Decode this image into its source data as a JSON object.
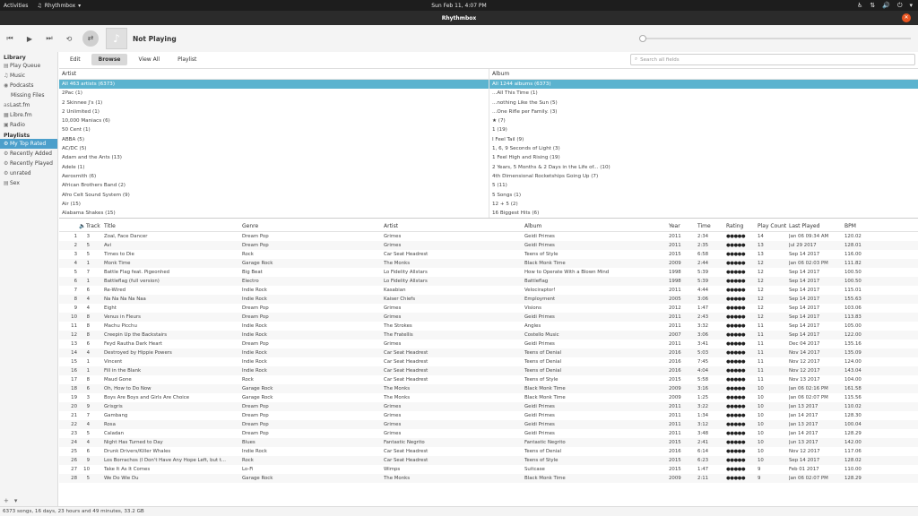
{
  "topbar": {
    "activities": "Activities",
    "app_name": "Rhythmbox",
    "clock": "Sun Feb 11,  4:07 PM"
  },
  "window": {
    "title": "Rhythmbox"
  },
  "player": {
    "now_playing": "Not Playing"
  },
  "sidebar": {
    "library_header": "Library",
    "library_items": [
      {
        "label": "Play Queue",
        "icon": "queue-icon"
      },
      {
        "label": "Music",
        "icon": "music-icon"
      },
      {
        "label": "Podcasts",
        "icon": "podcast-icon"
      },
      {
        "label": "Missing Files",
        "icon": ""
      }
    ],
    "online_items": [
      {
        "label": "Last.fm",
        "icon": "lastfm-icon"
      },
      {
        "label": "Libre.fm",
        "icon": "librefm-icon"
      },
      {
        "label": "Radio",
        "icon": "radio-icon"
      }
    ],
    "playlists_header": "Playlists",
    "playlist_items": [
      {
        "label": "My Top Rated",
        "icon": "smart-playlist-icon",
        "active": true
      },
      {
        "label": "Recently Added",
        "icon": "smart-playlist-icon"
      },
      {
        "label": "Recently Played",
        "icon": "smart-playlist-icon"
      },
      {
        "label": "unrated",
        "icon": "smart-playlist-icon"
      },
      {
        "label": "Sex",
        "icon": "playlist-icon"
      }
    ]
  },
  "tabs": [
    {
      "label": "Edit",
      "active": false
    },
    {
      "label": "Browse",
      "active": true
    },
    {
      "label": "View All",
      "active": false
    },
    {
      "label": "Playlist",
      "active": false
    }
  ],
  "search": {
    "placeholder": "Search all fields"
  },
  "browser": {
    "artist_header": "Artist",
    "album_header": "Album",
    "artists": [
      "All 463 artists (6373)",
      "2Pac (1)",
      "2 Skinnee J's (1)",
      "2 Unlimited (1)",
      "10,000 Maniacs (6)",
      "50 Cent (1)",
      "ABBA (5)",
      "AC/DC (5)",
      "Adam and the Ants (13)",
      "Adele (1)",
      "Aerosmith (6)",
      "African Brothers Band (2)",
      "Afro Celt Sound System (9)",
      "Air (15)",
      "Alabama Shakes (15)"
    ],
    "albums": [
      "All 1244 albums (6373)",
      "...All This Time (1)",
      "...nothing Like the Sun (5)",
      "...One Rifle per Family. (3)",
      "★ (7)",
      "1 (19)",
      "I Feel Tail (9)",
      "1, 6, 9 Seconds of Light (3)",
      "1 Feel High and Rising (19)",
      "2 Years, 5 Months & 2 Days in the Life of... (10)",
      "4th Dimensional Rocketships Going Up (7)",
      "5 (11)",
      "5 Songs (1)",
      "12 + 5 (2)",
      "16 Biggest Hits (6)"
    ]
  },
  "tracks": {
    "columns": {
      "track": "Track",
      "title": "Title",
      "genre": "Genre",
      "artist": "Artist",
      "album": "Album",
      "year": "Year",
      "time": "Time",
      "rating": "Rating",
      "play_count": "Play Count",
      "last_played": "Last Played",
      "bpm": "BPM"
    },
    "rows": [
      {
        "num": "1",
        "track": "3",
        "title": "Zoal, Face Dancer",
        "genre": "Dream Pop",
        "artist": "Grimes",
        "album": "Geidi Primes",
        "year": "2011",
        "time": "2:34",
        "stars": 5,
        "plays": "14",
        "last": "Jan 06 09:34 AM",
        "bpm": "120.02"
      },
      {
        "num": "2",
        "track": "5",
        "title": "Avi",
        "genre": "Dream Pop",
        "artist": "Grimes",
        "album": "Geidi Primes",
        "year": "2011",
        "time": "2:35",
        "stars": 5,
        "plays": "13",
        "last": "Jul 29 2017",
        "bpm": "128.01"
      },
      {
        "num": "3",
        "track": "5",
        "title": "Times to Die",
        "genre": "Rock",
        "artist": "Car Seat Headrest",
        "album": "Teens of Style",
        "year": "2015",
        "time": "6:58",
        "stars": 5,
        "plays": "13",
        "last": "Sep 14 2017",
        "bpm": "116.00"
      },
      {
        "num": "4",
        "track": "1",
        "title": "Monk Time",
        "genre": "Garage Rock",
        "artist": "The Monks",
        "album": "Black Monk Time",
        "year": "2009",
        "time": "2:44",
        "stars": 5,
        "plays": "12",
        "last": "Jan 06 02:03 PM",
        "bpm": "111.82"
      },
      {
        "num": "5",
        "track": "7",
        "title": "Battle Flag feat. Pigeonhed",
        "genre": "Big Beat",
        "artist": "Lo Fidelity Allstars",
        "album": "How to Operate With a Blown Mind",
        "year": "1998",
        "time": "5:39",
        "stars": 5,
        "plays": "12",
        "last": "Sep 14 2017",
        "bpm": "100.50"
      },
      {
        "num": "6",
        "track": "1",
        "title": "Battleflag (full version)",
        "genre": "Electro",
        "artist": "Lo Fidelity Allstars",
        "album": "Battleflag",
        "year": "1998",
        "time": "5:39",
        "stars": 5,
        "plays": "12",
        "last": "Sep 14 2017",
        "bpm": "100.50"
      },
      {
        "num": "7",
        "track": "6",
        "title": "Re-Wired",
        "genre": "Indie Rock",
        "artist": "Kasabian",
        "album": "Velociraptor!",
        "year": "2011",
        "time": "4:44",
        "stars": 5,
        "plays": "12",
        "last": "Sep 14 2017",
        "bpm": "115.01"
      },
      {
        "num": "8",
        "track": "4",
        "title": "Na Na Na Na Naa",
        "genre": "Indie Rock",
        "artist": "Kaiser Chiefs",
        "album": "Employment",
        "year": "2005",
        "time": "3:06",
        "stars": 5,
        "plays": "12",
        "last": "Sep 14 2017",
        "bpm": "155.63"
      },
      {
        "num": "9",
        "track": "4",
        "title": "Eight",
        "genre": "Dream Pop",
        "artist": "Grimes",
        "album": "Visions",
        "year": "2012",
        "time": "1:47",
        "stars": 5,
        "plays": "12",
        "last": "Sep 14 2017",
        "bpm": "103.06"
      },
      {
        "num": "10",
        "track": "8",
        "title": "Venus in Fleurs",
        "genre": "Dream Pop",
        "artist": "Grimes",
        "album": "Geidi Primes",
        "year": "2011",
        "time": "2:43",
        "stars": 5,
        "plays": "12",
        "last": "Sep 14 2017",
        "bpm": "113.83"
      },
      {
        "num": "11",
        "track": "8",
        "title": "Machu Picchu",
        "genre": "Indie Rock",
        "artist": "The Strokes",
        "album": "Angles",
        "year": "2011",
        "time": "3:32",
        "stars": 5,
        "plays": "11",
        "last": "Sep 14 2017",
        "bpm": "105.00"
      },
      {
        "num": "12",
        "track": "8",
        "title": "Creepin Up the Backstairs",
        "genre": "Indie Rock",
        "artist": "The Fratellis",
        "album": "Costello Music",
        "year": "2007",
        "time": "3:06",
        "stars": 5,
        "plays": "11",
        "last": "Sep 14 2017",
        "bpm": "122.00"
      },
      {
        "num": "13",
        "track": "6",
        "title": "Feyd Rautha Dark Heart",
        "genre": "Dream Pop",
        "artist": "Grimes",
        "album": "Geidi Primes",
        "year": "2011",
        "time": "3:41",
        "stars": 5,
        "plays": "11",
        "last": "Dec 04 2017",
        "bpm": "135.16"
      },
      {
        "num": "14",
        "track": "4",
        "title": "Destroyed by Hippie Powers",
        "genre": "Indie Rock",
        "artist": "Car Seat Headrest",
        "album": "Teens of Denial",
        "year": "2016",
        "time": "5:03",
        "stars": 5,
        "plays": "11",
        "last": "Nov 14 2017",
        "bpm": "135.09"
      },
      {
        "num": "15",
        "track": "1",
        "title": "Vincent",
        "genre": "Indie Rock",
        "artist": "Car Seat Headrest",
        "album": "Teens of Denial",
        "year": "2016",
        "time": "7:45",
        "stars": 5,
        "plays": "11",
        "last": "Nov 12 2017",
        "bpm": "124.00"
      },
      {
        "num": "16",
        "track": "1",
        "title": "Fill in the Blank",
        "genre": "Indie Rock",
        "artist": "Car Seat Headrest",
        "album": "Teens of Denial",
        "year": "2016",
        "time": "4:04",
        "stars": 5,
        "plays": "11",
        "last": "Nov 12 2017",
        "bpm": "143.04"
      },
      {
        "num": "17",
        "track": "8",
        "title": "Maud Gone",
        "genre": "Rock",
        "artist": "Car Seat Headrest",
        "album": "Teens of Style",
        "year": "2015",
        "time": "5:58",
        "stars": 5,
        "plays": "11",
        "last": "Nov 13 2017",
        "bpm": "104.00"
      },
      {
        "num": "18",
        "track": "6",
        "title": "Oh, How to Do Now",
        "genre": "Garage Rock",
        "artist": "The Monks",
        "album": "Black Monk Time",
        "year": "2009",
        "time": "3:16",
        "stars": 5,
        "plays": "10",
        "last": "Jan 06 02:16 PM",
        "bpm": "161.58"
      },
      {
        "num": "19",
        "track": "3",
        "title": "Boys Are Boys and Girls Are Choice",
        "genre": "Garage Rock",
        "artist": "The Monks",
        "album": "Black Monk Time",
        "year": "2009",
        "time": "1:25",
        "stars": 5,
        "plays": "10",
        "last": "Jan 06 02:07 PM",
        "bpm": "115.56"
      },
      {
        "num": "20",
        "track": "9",
        "title": "Grisgris",
        "genre": "Dream Pop",
        "artist": "Grimes",
        "album": "Geidi Primes",
        "year": "2011",
        "time": "3:22",
        "stars": 5,
        "plays": "10",
        "last": "Jan 13 2017",
        "bpm": "110.02"
      },
      {
        "num": "21",
        "track": "7",
        "title": "Gambang",
        "genre": "Dream Pop",
        "artist": "Grimes",
        "album": "Geidi Primes",
        "year": "2011",
        "time": "1:34",
        "stars": 5,
        "plays": "10",
        "last": "Jan 14 2017",
        "bpm": "128.30"
      },
      {
        "num": "22",
        "track": "4",
        "title": "Rosa",
        "genre": "Dream Pop",
        "artist": "Grimes",
        "album": "Geidi Primes",
        "year": "2011",
        "time": "3:12",
        "stars": 5,
        "plays": "10",
        "last": "Jan 13 2017",
        "bpm": "100.04"
      },
      {
        "num": "23",
        "track": "5",
        "title": "Caladan",
        "genre": "Dream Pop",
        "artist": "Grimes",
        "album": "Geidi Primes",
        "year": "2011",
        "time": "3:48",
        "stars": 5,
        "plays": "10",
        "last": "Jan 14 2017",
        "bpm": "128.29"
      },
      {
        "num": "24",
        "track": "4",
        "title": "Night Has Turned to Day",
        "genre": "Blues",
        "artist": "Fantastic Negrito",
        "album": "Fantastic Negrito",
        "year": "2015",
        "time": "2:41",
        "stars": 5,
        "plays": "10",
        "last": "Jun 13 2017",
        "bpm": "142.00"
      },
      {
        "num": "25",
        "track": "6",
        "title": "Drunk Drivers/Killer Whales",
        "genre": "Indie Rock",
        "artist": "Car Seat Headrest",
        "album": "Teens of Denial",
        "year": "2016",
        "time": "6:14",
        "stars": 5,
        "plays": "10",
        "last": "Nov 12 2017",
        "bpm": "117.06"
      },
      {
        "num": "26",
        "track": "9",
        "title": "Los Borrachos (I Don't Have Any Hope Left, but t...",
        "genre": "Rock",
        "artist": "Car Seat Headrest",
        "album": "Teens of Style",
        "year": "2015",
        "time": "6:23",
        "stars": 5,
        "plays": "10",
        "last": "Sep 14 2017",
        "bpm": "128.02"
      },
      {
        "num": "27",
        "track": "10",
        "title": "Take It As It Comes",
        "genre": "Lo-Fi",
        "artist": "Wimps",
        "album": "Suitcase",
        "year": "2015",
        "time": "1:47",
        "stars": 5,
        "plays": "9",
        "last": "Feb 01 2017",
        "bpm": "110.00"
      },
      {
        "num": "28",
        "track": "5",
        "title": "We Do Wie Du",
        "genre": "Garage Rock",
        "artist": "The Monks",
        "album": "Black Monk Time",
        "year": "2009",
        "time": "2:11",
        "stars": 5,
        "plays": "9",
        "last": "Jan 06 02:07 PM",
        "bpm": "128.29"
      }
    ]
  },
  "status": {
    "text": "6373 songs, 16 days, 23 hours and 49 minutes, 33.2 GB"
  }
}
